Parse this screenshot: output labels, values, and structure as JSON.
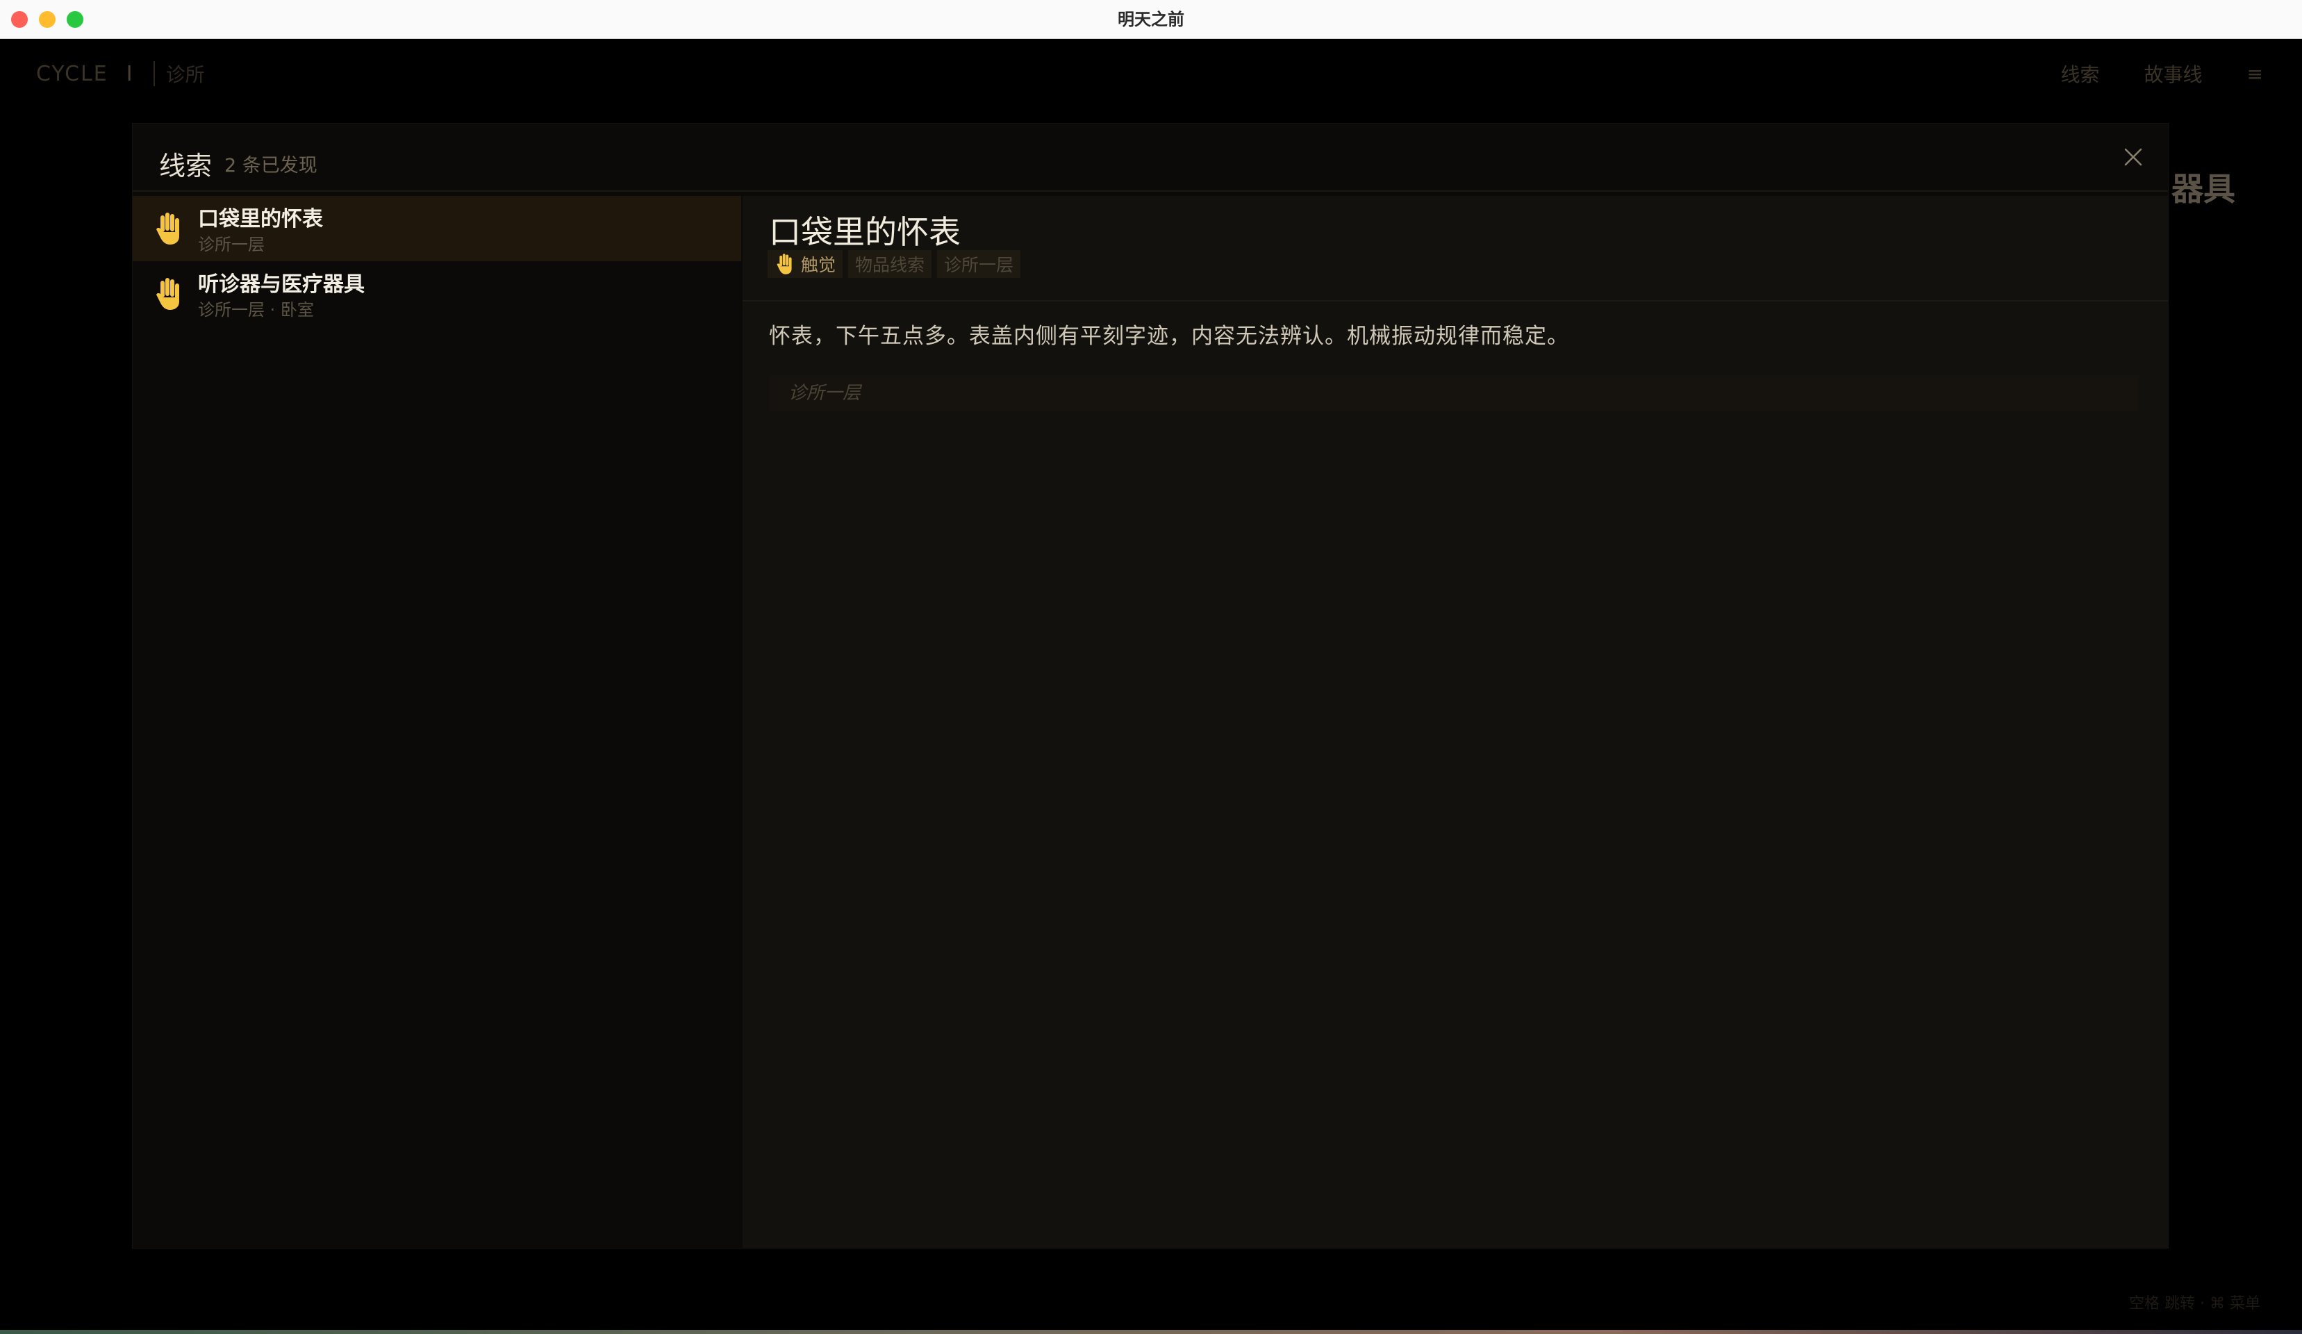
{
  "window": {
    "title": "明天之前"
  },
  "topbar": {
    "cycle_label": "CYCLE",
    "cycle_number": "I",
    "location": "诊所",
    "nav": {
      "clues": "线索",
      "storyline": "故事线",
      "menu_icon": "≡"
    }
  },
  "background": {
    "heading_fragment": "器具",
    "footer_hint": "空格 跳转 · ⌘ 菜单"
  },
  "modal": {
    "title": "线索",
    "count_text": "2 条已发现",
    "close_icon": "close-icon"
  },
  "clues": [
    {
      "icon": "hand-icon",
      "name": "口袋里的怀表",
      "location": "诊所一层",
      "selected": true
    },
    {
      "icon": "hand-icon",
      "name": "听诊器与医疗器具",
      "location": "诊所一层 · 卧室",
      "selected": false
    }
  ],
  "detail": {
    "title": "口袋里的怀表",
    "tags": {
      "sense": "触觉",
      "category": "物品线索",
      "place": "诊所一层"
    },
    "body": "怀表，下午五点多。表盖内侧有平刻字迹，内容无法辨认。机械振动规律而稳定。",
    "note": "诊所一层"
  },
  "colors": {
    "accent_hand": "#f5c542",
    "selected_row": "#1f170b",
    "panel_bg": "#0b0a08",
    "detail_bg": "#13110d"
  }
}
